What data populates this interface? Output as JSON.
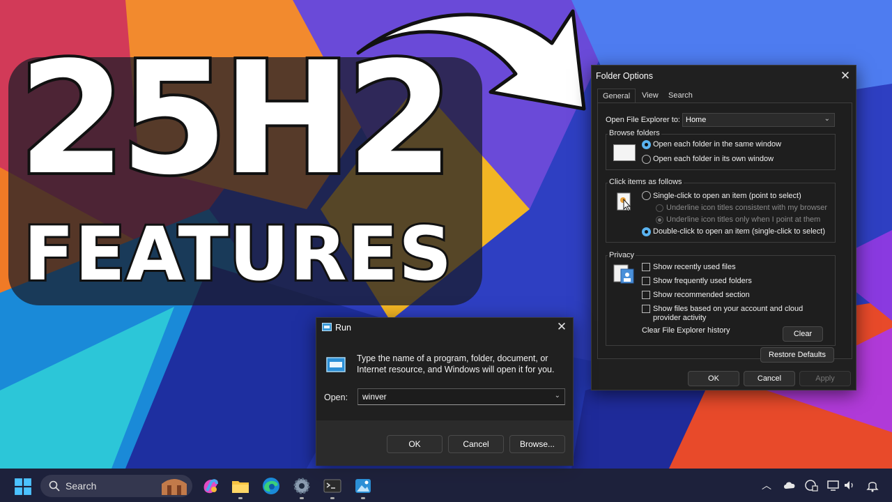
{
  "thumbnail": {
    "title_line1": "25H2",
    "title_line2": "FEATURES"
  },
  "folder_options": {
    "title": "Folder Options",
    "tabs": [
      "General",
      "View",
      "Search"
    ],
    "open_explorer_label": "Open File Explorer to:",
    "open_explorer_value": "Home",
    "browse_folders": {
      "label": "Browse folders",
      "option_same_window": "Open each folder in the same window",
      "option_own_window": "Open each folder in its own window",
      "selected": "same_window"
    },
    "click_items": {
      "label": "Click items as follows",
      "option_single_click": "Single-click to open an item (point to select)",
      "sub_underline_browser": "Underline icon titles consistent with my browser",
      "sub_underline_point": "Underline icon titles only when I point at them",
      "option_double_click": "Double-click to open an item (single-click to select)",
      "selected": "double_click"
    },
    "privacy": {
      "label": "Privacy",
      "show_recent_files": "Show recently used files",
      "show_frequent_folders": "Show frequently used folders",
      "show_recommended": "Show recommended section",
      "show_account_files_line1": "Show files based on your account and cloud",
      "show_account_files_line2": "provider activity",
      "clear_history_label": "Clear File Explorer history",
      "clear_button": "Clear"
    },
    "restore_defaults": "Restore Defaults",
    "ok": "OK",
    "cancel": "Cancel",
    "apply": "Apply"
  },
  "run_dialog": {
    "title": "Run",
    "description": "Type the name of a program, folder, document, or Internet resource, and Windows will open it for you.",
    "open_label": "Open:",
    "open_value": "winver",
    "ok": "OK",
    "cancel": "Cancel",
    "browse": "Browse..."
  },
  "taskbar": {
    "search_label": "Search",
    "pinned": [
      "start-icon",
      "copilot-icon",
      "file-explorer-icon",
      "edge-icon",
      "settings-icon",
      "terminal-icon",
      "photos-icon"
    ],
    "tray": [
      "chevron-up-icon",
      "cloud-icon",
      "vpn-icon",
      "network-icon",
      "volume-icon",
      "notification-icon"
    ]
  },
  "colors": {
    "accent": "#5ab3f0",
    "dialog_bg": "#202020",
    "taskbar_bg": "#1c1e30"
  }
}
